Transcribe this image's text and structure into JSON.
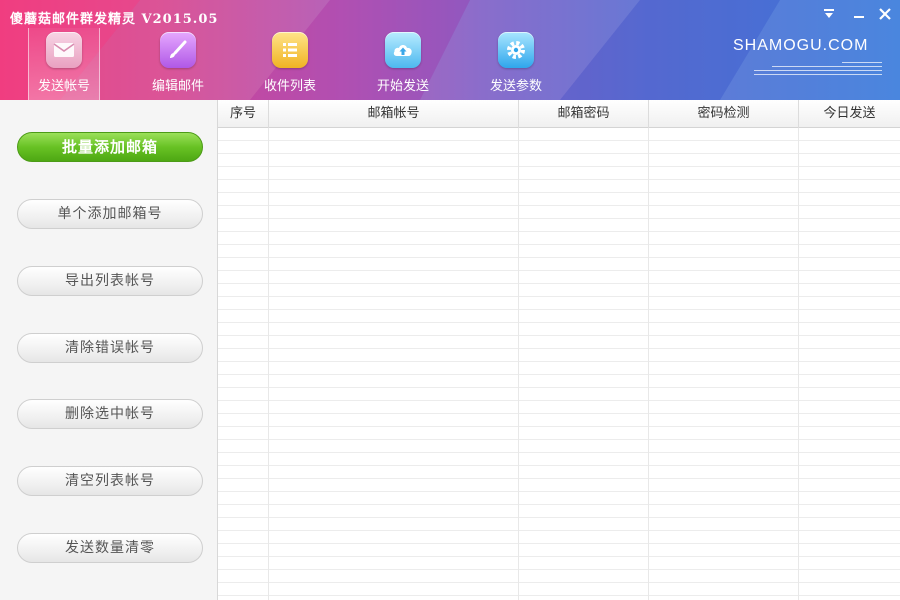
{
  "window": {
    "title": "傻蘑菇邮件群发精灵 V2015.05"
  },
  "toolbar": {
    "tabs": [
      {
        "label": "发送帐号",
        "icon": "mail-icon"
      },
      {
        "label": "编辑邮件",
        "icon": "brush-icon"
      },
      {
        "label": "收件列表",
        "icon": "list-icon"
      },
      {
        "label": "开始发送",
        "icon": "cloud-upload-icon"
      },
      {
        "label": "发送参数",
        "icon": "gear-icon"
      }
    ],
    "active_tab": 0
  },
  "brand": {
    "name": "SHAMOGU.COM"
  },
  "sidebar": {
    "buttons": [
      {
        "label": "批量添加邮箱"
      },
      {
        "label": "单个添加邮箱号"
      },
      {
        "label": "导出列表帐号"
      },
      {
        "label": "清除错误帐号"
      },
      {
        "label": "删除选中帐号"
      },
      {
        "label": "清空列表帐号"
      },
      {
        "label": "发送数量清零"
      }
    ]
  },
  "table": {
    "columns": [
      "序号",
      "邮箱帐号",
      "邮箱密码",
      "密码检测",
      "今日发送"
    ],
    "rows": []
  },
  "colors": {
    "header_start": "#e8347a",
    "header_end": "#3f7fdc",
    "primary_button": "#68c224"
  }
}
